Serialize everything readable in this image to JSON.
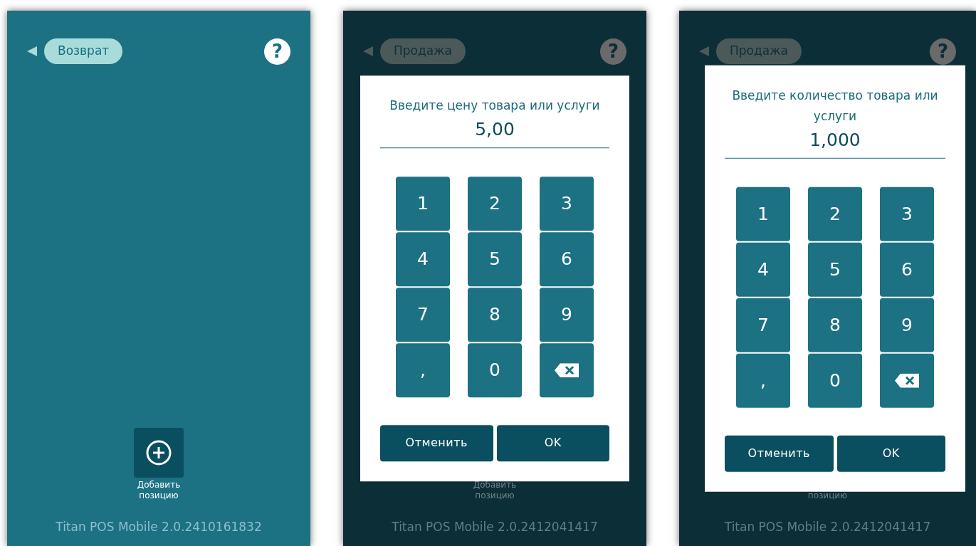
{
  "screens": [
    {
      "dimmed": false,
      "back_label": "Возврат",
      "help": "?",
      "add_button": {
        "label": "Добавить позицию"
      },
      "version": "Titan POS Mobile 2.0.2410161832"
    },
    {
      "dimmed": true,
      "back_label": "Продажа",
      "help": "?",
      "add_label": "Добавить позицию",
      "version": "Titan POS Mobile 2.0.2412041417",
      "dialog": {
        "title": "Введите цену товара или услуги",
        "value": "5,00",
        "keys": [
          {
            "kind": "digit",
            "label": "1"
          },
          {
            "kind": "digit",
            "label": "2"
          },
          {
            "kind": "digit",
            "label": "3"
          },
          {
            "kind": "digit",
            "label": "4"
          },
          {
            "kind": "digit",
            "label": "5"
          },
          {
            "kind": "digit",
            "label": "6"
          },
          {
            "kind": "digit",
            "label": "7"
          },
          {
            "kind": "digit",
            "label": "8"
          },
          {
            "kind": "digit",
            "label": "9"
          },
          {
            "kind": "digit",
            "label": ","
          },
          {
            "kind": "digit",
            "label": "0"
          },
          {
            "kind": "backspace"
          }
        ],
        "buttons": [
          "Отменить",
          "OK"
        ]
      }
    },
    {
      "dimmed": true,
      "back_label": "Продажа",
      "help": "?",
      "add_label": "позицию",
      "version": "Titan POS Mobile 2.0.2412041417",
      "dialog": {
        "title": "Введите количество товара или услуги",
        "value": "1,000",
        "keys": [
          {
            "kind": "digit",
            "label": "1"
          },
          {
            "kind": "digit",
            "label": "2"
          },
          {
            "kind": "digit",
            "label": "3"
          },
          {
            "kind": "digit",
            "label": "4"
          },
          {
            "kind": "digit",
            "label": "5"
          },
          {
            "kind": "digit",
            "label": "6"
          },
          {
            "kind": "digit",
            "label": "7"
          },
          {
            "kind": "digit",
            "label": "8"
          },
          {
            "kind": "digit",
            "label": "9"
          },
          {
            "kind": "digit",
            "label": ","
          },
          {
            "kind": "digit",
            "label": "0"
          },
          {
            "kind": "backspace"
          }
        ],
        "buttons": [
          "Отменить",
          "OK"
        ]
      }
    }
  ]
}
